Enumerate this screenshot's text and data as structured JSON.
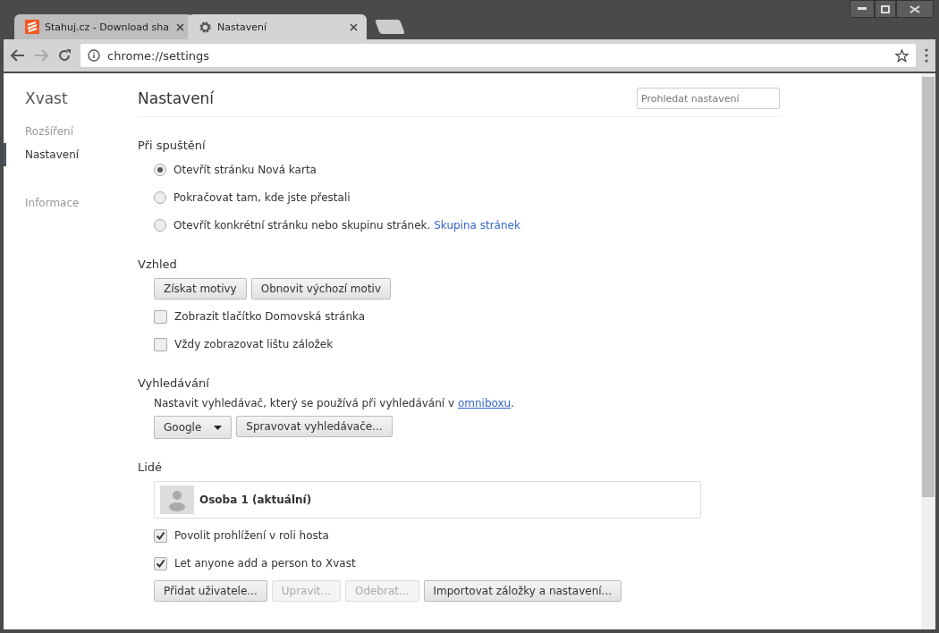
{
  "tabs": [
    {
      "kind": "site",
      "title": "Stahuj.cz - Download sha",
      "selected": false
    },
    {
      "kind": "settings",
      "title": "Nastavení",
      "selected": true
    }
  ],
  "address_bar": {
    "url": "chrome://settings"
  },
  "sidebar": {
    "brand": "Xvast",
    "items": [
      {
        "label": "Rozšíření",
        "selected": false
      },
      {
        "label": "Nastavení",
        "selected": true
      },
      {
        "label": "Informace",
        "selected": false
      }
    ]
  },
  "page": {
    "title": "Nastavení",
    "search_placeholder": "Prohledat nastavení"
  },
  "sections": [
    {
      "heading": "Při spuštění",
      "rows": [
        {
          "kind": "radio",
          "label": "Otevřít stránku Nová karta",
          "selected": true
        },
        {
          "kind": "radio",
          "label": "Pokračovat tam, kde jste přestali",
          "selected": false
        },
        {
          "kind": "radio",
          "label": "Otevřít konkrétní stránku nebo skupinu stránek.",
          "link": "Skupina stránek",
          "selected": false
        }
      ]
    },
    {
      "heading": "Vzhled",
      "rows": [
        {
          "kind": "buttons",
          "buttons": [
            {
              "label": "Získat motivy",
              "disabled": false
            },
            {
              "label": "Obnovit výchozí motiv",
              "disabled": false
            }
          ]
        },
        {
          "kind": "checkbox",
          "label": "Zobrazit tlačítko Domovská stránka",
          "checked": false
        },
        {
          "kind": "checkbox",
          "label": "Vždy zobrazovat lištu záložek",
          "checked": false
        }
      ]
    },
    {
      "heading": "Vyhledávání",
      "rows": [
        {
          "kind": "text",
          "before": "Nastavit vyhledávač, který se používá při vyhledávání v ",
          "link": "omniboxu",
          "after": "."
        },
        {
          "kind": "buttons",
          "select": "Google",
          "buttons": [
            {
              "label": "Spravovat vyhledávače...",
              "disabled": false
            }
          ]
        }
      ]
    },
    {
      "heading": "Lidé",
      "rows": [
        {
          "kind": "profile",
          "name": "Osoba 1 (aktuální)"
        },
        {
          "kind": "checkbox",
          "label": "Povolit prohlížení v roli hosta",
          "checked": true
        },
        {
          "kind": "checkbox",
          "label": "Let anyone add a person to Xvast",
          "checked": true
        },
        {
          "kind": "buttons",
          "buttons": [
            {
              "label": "Přidat uživatele...",
              "disabled": false
            },
            {
              "label": "Upravit...",
              "disabled": true
            },
            {
              "label": "Odebrat...",
              "disabled": true
            },
            {
              "label": "Importovat záložky a nastavení...",
              "disabled": false
            }
          ]
        }
      ]
    }
  ]
}
